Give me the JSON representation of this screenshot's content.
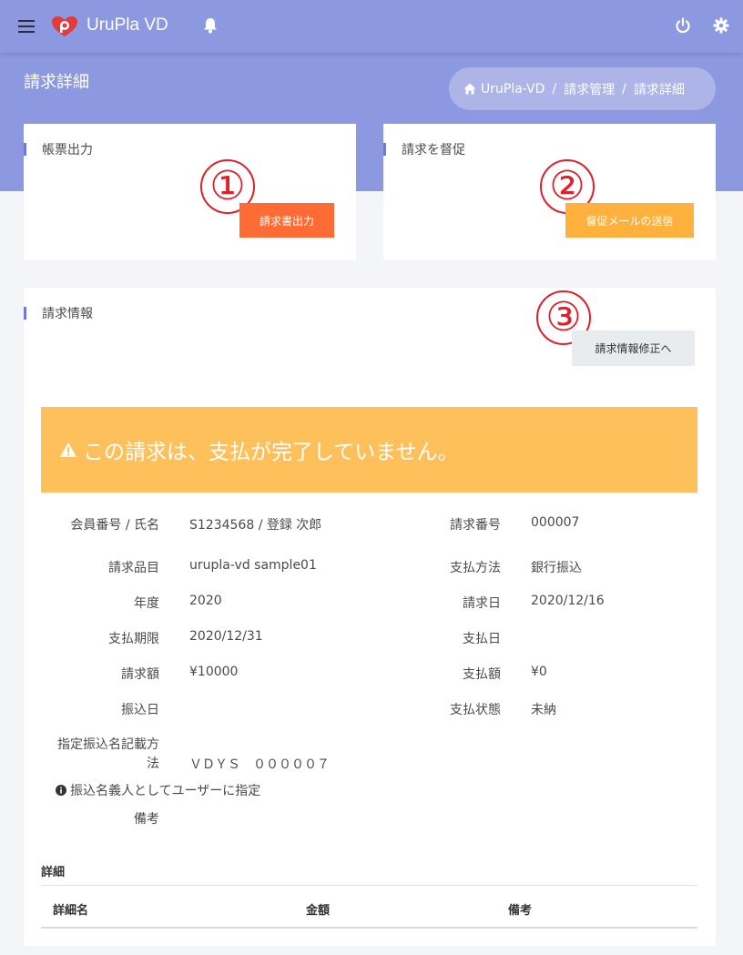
{
  "header": {
    "app_name": "UruPla VD",
    "menu_icon": "hamburger-menu-icon",
    "logo_icon": "urupla-logo-icon",
    "bell_icon": "bell-icon",
    "power_icon": "power-icon",
    "gear_icon": "gear-icon"
  },
  "page": {
    "title": "請求詳細",
    "breadcrumb": {
      "home_icon": "home-icon",
      "items": [
        "UruPla-VD",
        "請求管理",
        "請求詳細"
      ]
    }
  },
  "cards": {
    "output": {
      "title": "帳票出力",
      "button": "請求書出力",
      "marker": "①",
      "button_color": "#ff6b35"
    },
    "reminder": {
      "title": "請求を督促",
      "button": "督促メールの送信",
      "marker": "②",
      "button_color": "#ffb13d"
    },
    "info": {
      "title": "請求情報",
      "button": "請求情報修正へ",
      "marker": "③"
    }
  },
  "alert": {
    "icon": "warning-icon",
    "text": "この請求は、支払が完了していません。",
    "color": "#fec05b"
  },
  "details": {
    "left": [
      {
        "label": "会員番号 / 氏名",
        "value": "S1234568 / 登録 次郎"
      },
      {
        "label": "請求品目",
        "value": "urupla-vd sample01"
      },
      {
        "label": "年度",
        "value": "2020"
      },
      {
        "label": "支払期限",
        "value": "2020/12/31"
      },
      {
        "label": "請求額",
        "value": "¥10000"
      },
      {
        "label": "振込日",
        "value": ""
      }
    ],
    "right": [
      {
        "label": "請求番号",
        "value": "000007"
      },
      {
        "label": "支払方法",
        "value": "銀行振込"
      },
      {
        "label": "請求日",
        "value": "2020/12/16"
      },
      {
        "label": "支払日",
        "value": ""
      },
      {
        "label": "支払額",
        "value": "¥0"
      },
      {
        "label": "支払状態",
        "value": "未納"
      }
    ],
    "transfer_label_line1": "指定振込名記載方",
    "transfer_label_line2": "法",
    "transfer_value": "ＶＤＹＳ　０００００７",
    "transfer_note_icon": "info-circle-icon",
    "transfer_note": "振込名義人としてユーザーに指定",
    "remarks_label": "備考",
    "remarks_value": ""
  },
  "detail_table": {
    "heading": "詳細",
    "columns": [
      "詳細名",
      "金額",
      "備考"
    ]
  }
}
